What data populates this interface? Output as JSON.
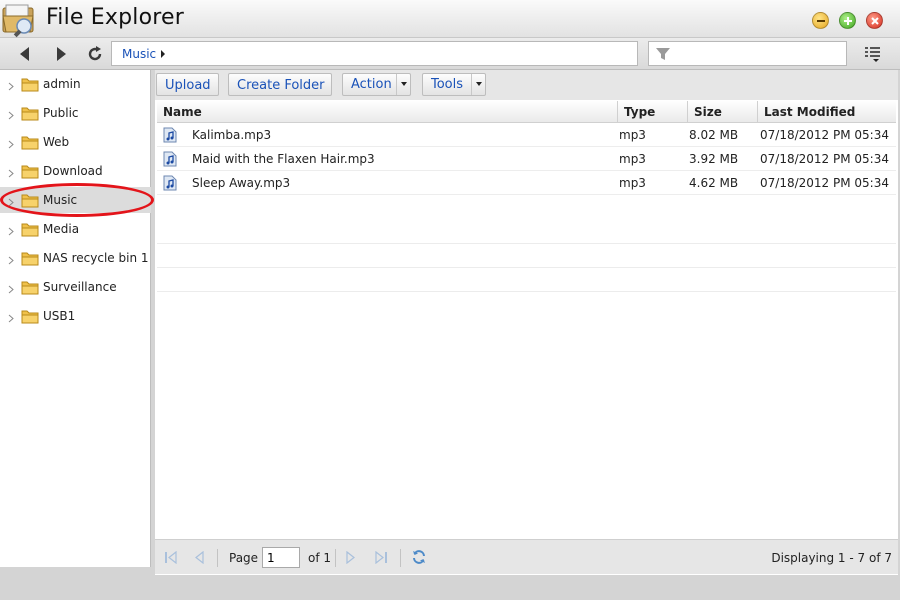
{
  "window": {
    "title": "File Explorer"
  },
  "nav": {
    "breadcrumb": "Music",
    "filter_placeholder": ""
  },
  "sidebar": {
    "items": [
      {
        "label": "admin"
      },
      {
        "label": "Public"
      },
      {
        "label": "Web"
      },
      {
        "label": "Download"
      },
      {
        "label": "Music",
        "selected": true
      },
      {
        "label": "Media"
      },
      {
        "label": "NAS recycle bin 1"
      },
      {
        "label": "Surveillance"
      },
      {
        "label": "USB1"
      }
    ]
  },
  "toolbar": {
    "upload": "Upload",
    "create_folder": "Create Folder",
    "action": "Action",
    "tools": "Tools"
  },
  "grid": {
    "columns": [
      "Name",
      "Type",
      "Size",
      "Last Modified"
    ],
    "rows": [
      {
        "name": "Kalimba.mp3",
        "type": "mp3",
        "size": "8.02 MB",
        "modified": "07/18/2012 PM 05:34"
      },
      {
        "name": "Maid with the Flaxen Hair.mp3",
        "type": "mp3",
        "size": "3.92 MB",
        "modified": "07/18/2012 PM 05:34"
      },
      {
        "name": "Sleep Away.mp3",
        "type": "mp3",
        "size": "4.62 MB",
        "modified": "07/18/2012 PM 05:34"
      }
    ]
  },
  "pager": {
    "page_label": "Page",
    "page_value": "1",
    "of_label": "of 1",
    "display": "Displaying 1 - 7 of 7"
  },
  "colors": {
    "link_blue": "#1a52b8",
    "highlight_red": "#e3141a"
  }
}
